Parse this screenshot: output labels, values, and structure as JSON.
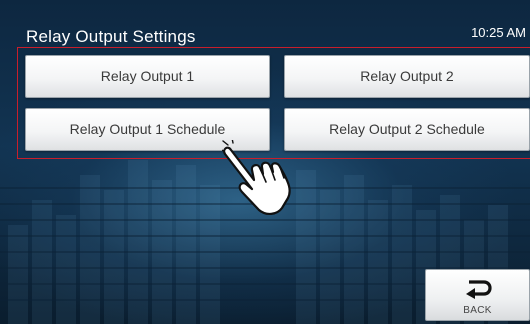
{
  "header": {
    "title": "Relay Output Settings",
    "clock": "10:25 AM"
  },
  "menu": {
    "relay1": "Relay Output 1",
    "relay2": "Relay Output 2",
    "relay1_schedule": "Relay Output 1 Schedule",
    "relay2_schedule": "Relay Output 2 Schedule"
  },
  "footer": {
    "back_label": "BACK"
  },
  "icons": {
    "pointer": "hand-pointer-icon",
    "back": "return-arrow-icon"
  },
  "colors": {
    "frame": "#c81e2b",
    "background": "#123452",
    "button": "#f4f5f6"
  }
}
